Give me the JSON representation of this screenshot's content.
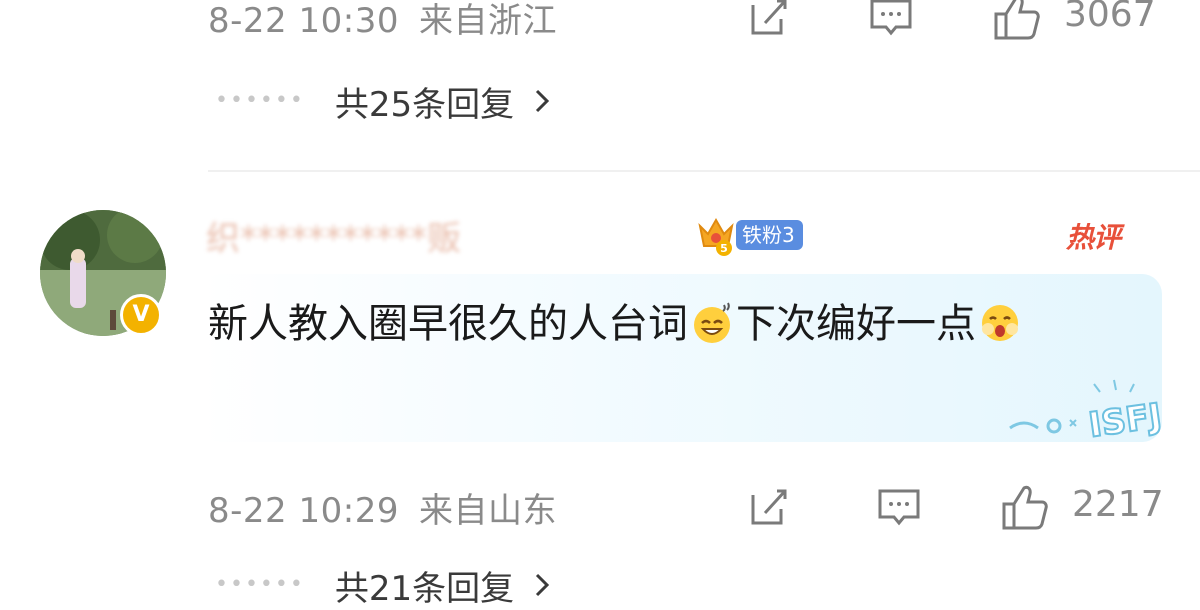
{
  "first_comment": {
    "time": "8-22 10:30",
    "location": "来自浙江",
    "likes": "3067",
    "replies_label": "共25条回复"
  },
  "hot_comment": {
    "username": "织***********贩",
    "fan_badge": "铁粉3",
    "hot_tag": "热评",
    "text_part1": "新人教入圈早很久的人台词",
    "text_part2": "下次编好一点",
    "sticker_text": "ISFJ",
    "time": "8-22 10:29",
    "location": "来自山东",
    "likes": "2217",
    "replies_label": "共21条回复"
  },
  "colors": {
    "meta_gray": "#8a8a8a",
    "fan_badge_blue": "#5a8de0",
    "hot_red": "#e8503a",
    "verified_gold": "#f3b200"
  },
  "icons": [
    "share-icon",
    "comment-icon",
    "like-icon",
    "chevron-right-icon",
    "verified-icon",
    "crown-icon"
  ]
}
